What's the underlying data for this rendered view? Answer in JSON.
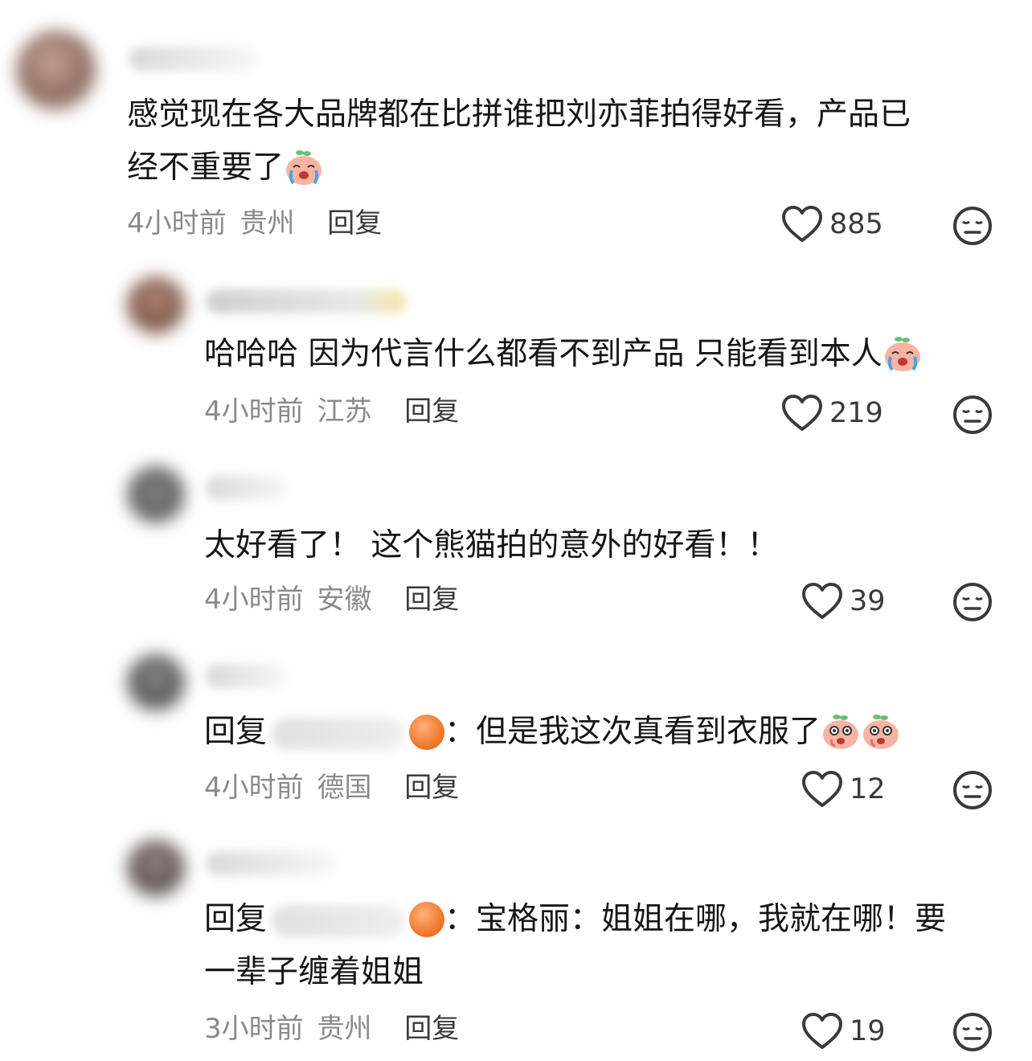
{
  "comments": [
    {
      "text_lines": [
        "感觉现在各大品牌都在比拼谁把刘亦菲拍得好看，产品已",
        "经不重要了"
      ],
      "time": "4小时前",
      "location": "贵州",
      "reply_label": "回复",
      "likes": "885",
      "emoji": "crying-peach"
    },
    {
      "text_lines": [
        "哈哈哈 因为代言什么都看不到产品 只能看到本人"
      ],
      "time": "4小时前",
      "location": "江苏",
      "reply_label": "回复",
      "likes": "219",
      "emoji": "crying-peach"
    },
    {
      "text_lines": [
        "太好看了！ 这个熊猫拍的意外的好看！！"
      ],
      "time": "4小时前",
      "location": "安徽",
      "reply_label": "回复",
      "likes": "39"
    },
    {
      "reply_prefix": "回复",
      "text_lines": [
        "：但是我这次真看到衣服了"
      ],
      "time": "4小时前",
      "location": "德国",
      "reply_label": "回复",
      "likes": "12",
      "emoji": "shocked-peach"
    },
    {
      "reply_prefix": "回复",
      "text_lines": [
        "：宝格丽：姐姐在哪，我就在哪！要",
        "一辈子缠着姐姐"
      ],
      "time": "3小时前",
      "location": "贵州",
      "reply_label": "回复",
      "likes": "19"
    }
  ],
  "icons": {
    "like": "heart-outline-icon",
    "dislike": "neutral-face-icon"
  },
  "colors": {
    "text": "#161616",
    "meta": "#8a8a8a",
    "icon": "#3a3a3a"
  }
}
